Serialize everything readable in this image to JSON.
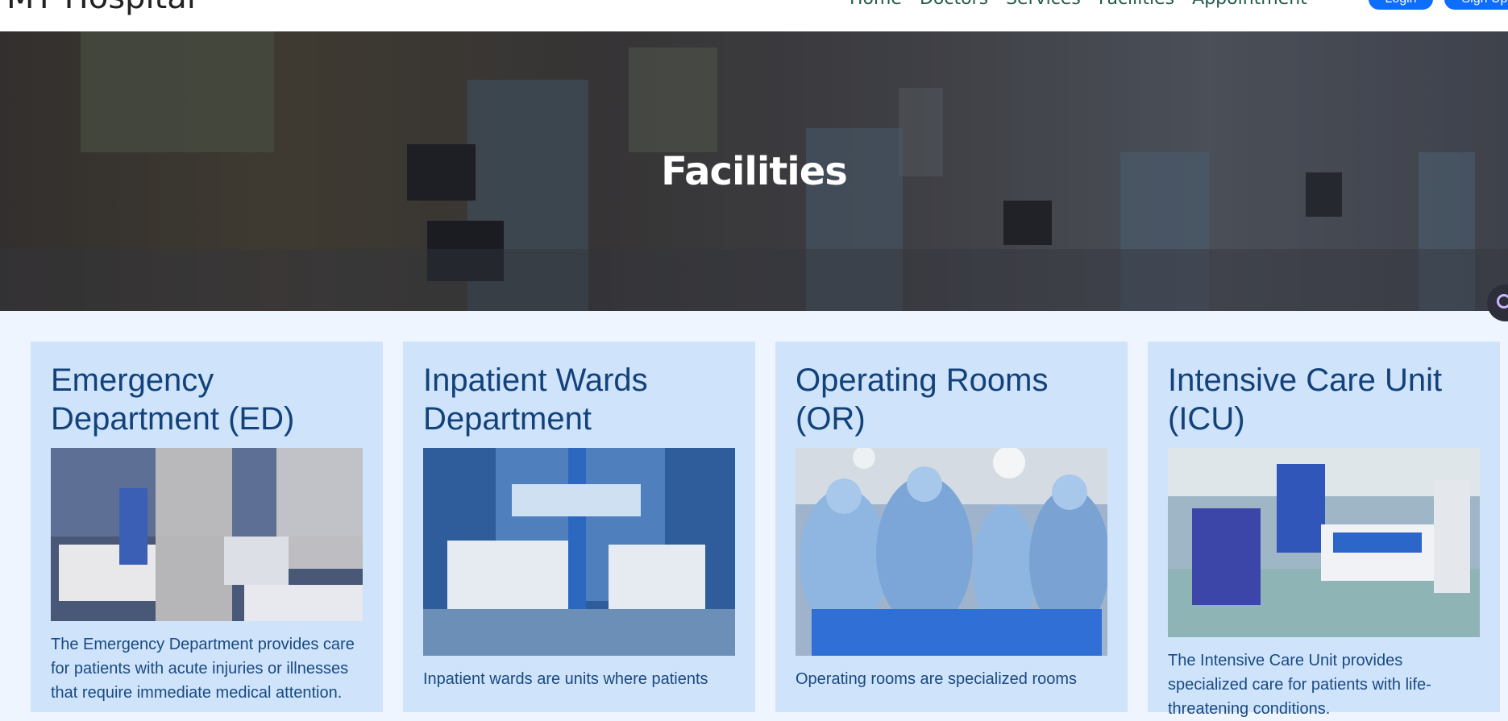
{
  "navbar": {
    "brand": "MY Hospital",
    "links": [
      "Home",
      "Doctors",
      "Services",
      "Facilities",
      "Appointment"
    ],
    "login_label": "Login",
    "signup_label": "Sign Up"
  },
  "hero": {
    "title": "Facilities"
  },
  "cards": [
    {
      "title": "Emergency Department (ED)",
      "image_alt": "Emergency department with patients in beds and medical staff",
      "text": "The Emergency Department provides care for patients with acute injuries or illnesses that require immediate medical attention."
    },
    {
      "title": "Inpatient Wards Department",
      "image_alt": "Inpatient ward with two empty beds",
      "text": "Inpatient wards are units where patients"
    },
    {
      "title": "Operating Rooms (OR)",
      "image_alt": "Surgeons operating in an operating room",
      "text": "Operating rooms are specialized rooms"
    },
    {
      "title": "Intensive Care Unit (ICU)",
      "image_alt": "Intensive care unit with beds and medical equipment",
      "text": "The Intensive Care Unit provides specialized care for patients with life-threatening conditions."
    }
  ],
  "colors": {
    "page_background": "#eef5ff",
    "card_background": "#cfe3fb",
    "card_title": "#13427a",
    "card_text": "#1a4a80",
    "primary_button": "#0d6efd",
    "nav_link": "#1f5b4b"
  },
  "icons": {
    "chat_widget": "chat-widget-icon"
  }
}
